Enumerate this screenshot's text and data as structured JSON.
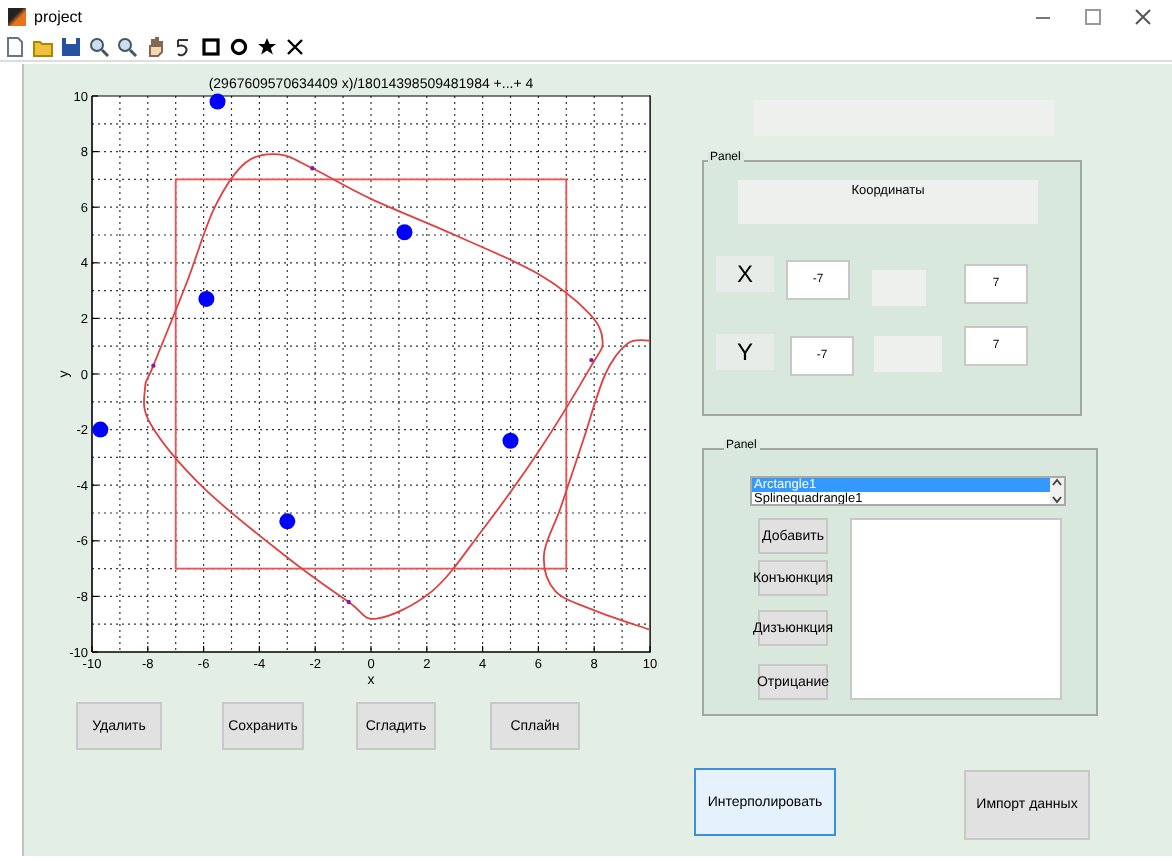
{
  "window": {
    "title": "project"
  },
  "plot": {
    "chart_data": {
      "type": "scatter",
      "title": "(2967609570634409 x)/18014398509481984 +...+ 4",
      "xlabel": "x",
      "ylabel": "y",
      "x": [
        -5.5,
        1.2,
        -5.9,
        -9.7,
        5,
        -3
      ],
      "grid": true,
      "series": [
        {
          "color": "#0000ff",
          "values": [
            9.8,
            5.1,
            2.7,
            -2,
            -2.4,
            -5.3
          ]
        },
        {
          "type": "line",
          "color": "#e04040",
          "x": [
            10,
            9.2,
            8.4,
            7.6,
            6.8,
            6.2,
            6.6,
            8,
            10
          ],
          "values": [
            1.2,
            1.1,
            0,
            -2.4,
            -4.8,
            -6.5,
            -7.8,
            -8.5,
            -9.2
          ]
        }
      ],
      "xlim": [
        -10,
        10
      ],
      "ylim": [
        -10,
        10
      ],
      "xticks": [
        -10,
        -8,
        -6,
        -4,
        -2,
        0,
        2,
        4,
        6,
        8,
        10
      ],
      "yticks": [
        -10,
        -8,
        -6,
        -4,
        -2,
        0,
        2,
        4,
        6,
        8,
        10
      ]
    }
  },
  "coordinates_panel": {
    "title": "Panel",
    "header": "Координаты",
    "rows": [
      {
        "label": "X",
        "from": "-7",
        "to": "7"
      },
      {
        "label": "Y",
        "from": "-7",
        "to": "7"
      }
    ]
  },
  "operations_panel": {
    "title": "Panel",
    "list": [
      {
        "label": "Arctangle1",
        "selected": true
      },
      {
        "label": "Splinequadrangle1",
        "selected": false
      }
    ],
    "buttons": [
      "Добавить",
      "Конъюнкция",
      "Дизъюнкция",
      "Отрицание"
    ]
  },
  "bottom_buttons": [
    "Удалить",
    "Сохранить",
    "Сгладить",
    "Сплайн"
  ],
  "action_buttons": [
    {
      "label": "Интерполировать",
      "focused": true
    },
    {
      "label": "Импорт данных",
      "focused": false
    }
  ]
}
